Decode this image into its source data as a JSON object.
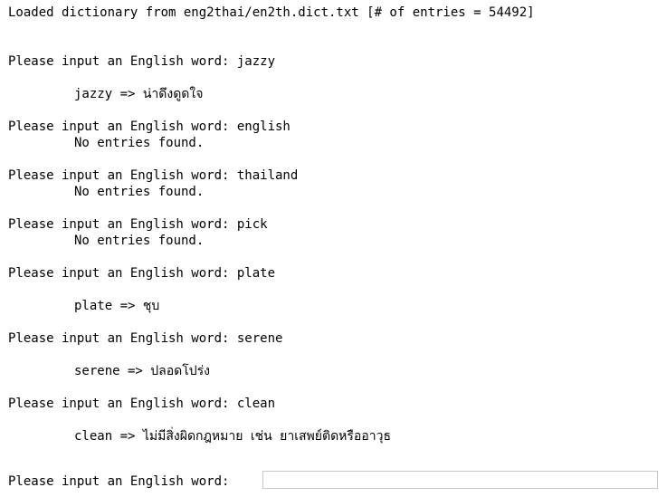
{
  "header": {
    "loaded_line": "Loaded dictionary from eng2thai/en2th.dict.txt [# of entries = 54492]"
  },
  "prompt_label": "Please input an English word:",
  "history": [
    {
      "prompt": "Please input an English word: jazzy",
      "result": "jazzy => น่าดึงดูดใจ"
    },
    {
      "prompt": "Please input an English word: english",
      "result": "No entries found."
    },
    {
      "prompt": "Please input an English word: thailand",
      "result": "No entries found."
    },
    {
      "prompt": "Please input an English word: pick",
      "result": "No entries found."
    },
    {
      "prompt": "Please input an English word: plate",
      "result": "plate => ชุบ"
    },
    {
      "prompt": "Please input an English word: serene",
      "result": "serene => ปลอดโปร่ง"
    },
    {
      "prompt": "Please input an English word: clean",
      "result": "clean => ไม่มีสิ่งผิดกฎหมาย เช่น ยาเสพย์ติดหรืออาวุธ"
    }
  ],
  "current_input": {
    "value": "",
    "placeholder": ""
  }
}
